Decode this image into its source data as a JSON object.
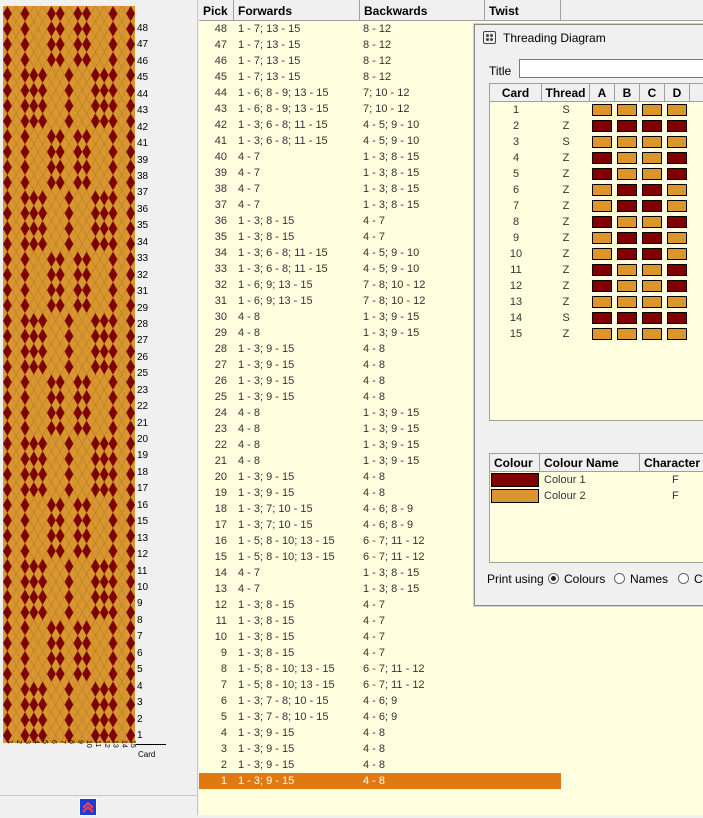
{
  "grid": {
    "headers": {
      "pick": "Pick",
      "forwards": "Forwards",
      "backwards": "Backwards",
      "twist": "Twist"
    },
    "rows": [
      {
        "pick": "48",
        "forwards": "1 - 7; 13 - 15",
        "backwards": "8 - 12"
      },
      {
        "pick": "47",
        "forwards": "1 - 7; 13 - 15",
        "backwards": "8 - 12"
      },
      {
        "pick": "46",
        "forwards": "1 - 7; 13 - 15",
        "backwards": "8 - 12"
      },
      {
        "pick": "45",
        "forwards": "1 - 7; 13 - 15",
        "backwards": "8 - 12"
      },
      {
        "pick": "44",
        "forwards": "1 - 6; 8 - 9; 13 - 15",
        "backwards": "7; 10 - 12"
      },
      {
        "pick": "43",
        "forwards": "1 - 6; 8 - 9; 13 - 15",
        "backwards": "7; 10 - 12"
      },
      {
        "pick": "42",
        "forwards": "1 - 3; 6 - 8; 11 - 15",
        "backwards": "4 - 5; 9 - 10"
      },
      {
        "pick": "41",
        "forwards": "1 - 3; 6 - 8; 11 - 15",
        "backwards": "4 - 5; 9 - 10"
      },
      {
        "pick": "40",
        "forwards": "4 - 7",
        "backwards": "1 - 3; 8 - 15"
      },
      {
        "pick": "39",
        "forwards": "4 - 7",
        "backwards": "1 - 3; 8 - 15"
      },
      {
        "pick": "38",
        "forwards": "4 - 7",
        "backwards": "1 - 3; 8 - 15"
      },
      {
        "pick": "37",
        "forwards": "4 - 7",
        "backwards": "1 - 3; 8 - 15"
      },
      {
        "pick": "36",
        "forwards": "1 - 3; 8 - 15",
        "backwards": "4 - 7"
      },
      {
        "pick": "35",
        "forwards": "1 - 3; 8 - 15",
        "backwards": "4 - 7"
      },
      {
        "pick": "34",
        "forwards": "1 - 3; 6 - 8; 11 - 15",
        "backwards": "4 - 5; 9 - 10"
      },
      {
        "pick": "33",
        "forwards": "1 - 3; 6 - 8; 11 - 15",
        "backwards": "4 - 5; 9 - 10"
      },
      {
        "pick": "32",
        "forwards": "1 - 6; 9; 13 - 15",
        "backwards": "7 - 8; 10 - 12"
      },
      {
        "pick": "31",
        "forwards": "1 - 6; 9; 13 - 15",
        "backwards": "7 - 8; 10 - 12"
      },
      {
        "pick": "30",
        "forwards": "4 - 8",
        "backwards": "1 - 3; 9 - 15"
      },
      {
        "pick": "29",
        "forwards": "4 - 8",
        "backwards": "1 - 3; 9 - 15"
      },
      {
        "pick": "28",
        "forwards": "1 - 3; 9 - 15",
        "backwards": "4 - 8"
      },
      {
        "pick": "27",
        "forwards": "1 - 3; 9 - 15",
        "backwards": "4 - 8"
      },
      {
        "pick": "26",
        "forwards": "1 - 3; 9 - 15",
        "backwards": "4 - 8"
      },
      {
        "pick": "25",
        "forwards": "1 - 3; 9 - 15",
        "backwards": "4 - 8"
      },
      {
        "pick": "24",
        "forwards": "4 - 8",
        "backwards": "1 - 3; 9 - 15"
      },
      {
        "pick": "23",
        "forwards": "4 - 8",
        "backwards": "1 - 3; 9 - 15"
      },
      {
        "pick": "22",
        "forwards": "4 - 8",
        "backwards": "1 - 3; 9 - 15"
      },
      {
        "pick": "21",
        "forwards": "4 - 8",
        "backwards": "1 - 3; 9 - 15"
      },
      {
        "pick": "20",
        "forwards": "1 - 3; 9 - 15",
        "backwards": "4 - 8"
      },
      {
        "pick": "19",
        "forwards": "1 - 3; 9 - 15",
        "backwards": "4 - 8"
      },
      {
        "pick": "18",
        "forwards": "1 - 3; 7; 10 - 15",
        "backwards": "4 - 6; 8 - 9"
      },
      {
        "pick": "17",
        "forwards": "1 - 3; 7; 10 - 15",
        "backwards": "4 - 6; 8 - 9"
      },
      {
        "pick": "16",
        "forwards": "1 - 5; 8 - 10; 13 - 15",
        "backwards": "6 - 7; 11 - 12"
      },
      {
        "pick": "15",
        "forwards": "1 - 5; 8 - 10; 13 - 15",
        "backwards": "6 - 7; 11 - 12"
      },
      {
        "pick": "14",
        "forwards": "4 - 7",
        "backwards": "1 - 3; 8 - 15"
      },
      {
        "pick": "13",
        "forwards": "4 - 7",
        "backwards": "1 - 3; 8 - 15"
      },
      {
        "pick": "12",
        "forwards": "1 - 3; 8 - 15",
        "backwards": "4 - 7"
      },
      {
        "pick": "11",
        "forwards": "1 - 3; 8 - 15",
        "backwards": "4 - 7"
      },
      {
        "pick": "10",
        "forwards": "1 - 3; 8 - 15",
        "backwards": "4 - 7"
      },
      {
        "pick": "9",
        "forwards": "1 - 3; 8 - 15",
        "backwards": "4 - 7"
      },
      {
        "pick": "8",
        "forwards": "1 - 5; 8 - 10; 13 - 15",
        "backwards": "6 - 7; 11 - 12"
      },
      {
        "pick": "7",
        "forwards": "1 - 5; 8 - 10; 13 - 15",
        "backwards": "6 - 7; 11 - 12"
      },
      {
        "pick": "6",
        "forwards": "1 - 3; 7 - 8; 10 - 15",
        "backwards": "4 - 6; 9"
      },
      {
        "pick": "5",
        "forwards": "1 - 3; 7 - 8; 10 - 15",
        "backwards": "4 - 6; 9"
      },
      {
        "pick": "4",
        "forwards": "1 - 3; 9 - 15",
        "backwards": "4 - 8"
      },
      {
        "pick": "3",
        "forwards": "1 - 3; 9 - 15",
        "backwards": "4 - 8"
      },
      {
        "pick": "2",
        "forwards": "1 - 3; 9 - 15",
        "backwards": "4 - 8"
      },
      {
        "pick": "1",
        "forwards": "1 - 3; 9 - 15",
        "backwards": "4 - 8",
        "selected": true
      }
    ]
  },
  "preview": {
    "row_labels": [
      "48",
      "47",
      "46",
      "45",
      "44",
      "43",
      "42",
      "41",
      "39",
      "38",
      "37",
      "36",
      "35",
      "34",
      "33",
      "32",
      "31",
      "29",
      "28",
      "27",
      "26",
      "25",
      "23",
      "22",
      "21",
      "20",
      "19",
      "18",
      "17",
      "16",
      "15",
      "13",
      "12",
      "11",
      "10",
      "9",
      "8",
      "7",
      "6",
      "5",
      "4",
      "3",
      "2",
      "1"
    ],
    "card_numbers": [
      "1",
      "2",
      "3",
      "4",
      "5",
      "6",
      "7",
      "8",
      "9",
      "10",
      "11",
      "12",
      "13",
      "14",
      "15"
    ],
    "card_word": "Card",
    "colors": {
      "dark": "#7f0000",
      "light": "#d9962e"
    }
  },
  "dialog": {
    "title": "Threading Diagram",
    "title_field_label": "Title",
    "title_value": "",
    "threading_headers": {
      "card": "Card",
      "thread": "Thread",
      "a": "A",
      "b": "B",
      "c": "C",
      "d": "D"
    },
    "cards": [
      {
        "card": "1",
        "thread": "S",
        "holes": [
          2,
          2,
          2,
          2
        ]
      },
      {
        "card": "2",
        "thread": "Z",
        "holes": [
          1,
          1,
          1,
          1
        ]
      },
      {
        "card": "3",
        "thread": "S",
        "holes": [
          2,
          2,
          2,
          2
        ]
      },
      {
        "card": "4",
        "thread": "Z",
        "holes": [
          1,
          2,
          2,
          1
        ]
      },
      {
        "card": "5",
        "thread": "Z",
        "holes": [
          1,
          2,
          2,
          1
        ]
      },
      {
        "card": "6",
        "thread": "Z",
        "holes": [
          2,
          1,
          1,
          2
        ]
      },
      {
        "card": "7",
        "thread": "Z",
        "holes": [
          2,
          1,
          1,
          2
        ]
      },
      {
        "card": "8",
        "thread": "Z",
        "holes": [
          1,
          2,
          2,
          1
        ]
      },
      {
        "card": "9",
        "thread": "Z",
        "holes": [
          2,
          1,
          1,
          2
        ]
      },
      {
        "card": "10",
        "thread": "Z",
        "holes": [
          2,
          1,
          1,
          2
        ]
      },
      {
        "card": "11",
        "thread": "Z",
        "holes": [
          1,
          2,
          2,
          1
        ]
      },
      {
        "card": "12",
        "thread": "Z",
        "holes": [
          1,
          2,
          2,
          1
        ]
      },
      {
        "card": "13",
        "thread": "Z",
        "holes": [
          2,
          2,
          2,
          2
        ]
      },
      {
        "card": "14",
        "thread": "S",
        "holes": [
          1,
          1,
          1,
          1
        ]
      },
      {
        "card": "15",
        "thread": "Z",
        "holes": [
          2,
          2,
          2,
          2
        ]
      }
    ],
    "colour_headers": {
      "colour": "Colour",
      "name": "Colour Name",
      "character": "Character"
    },
    "colours": [
      {
        "name": "Colour 1",
        "character": "F",
        "hex": "#7f0000"
      },
      {
        "name": "Colour 2",
        "character": "F",
        "hex": "#d9962e"
      }
    ],
    "print_using_label": "Print using",
    "print_options": [
      {
        "label": "Colours",
        "checked": true
      },
      {
        "label": "Names",
        "checked": false
      },
      {
        "label": "Ch",
        "checked": false
      }
    ]
  }
}
